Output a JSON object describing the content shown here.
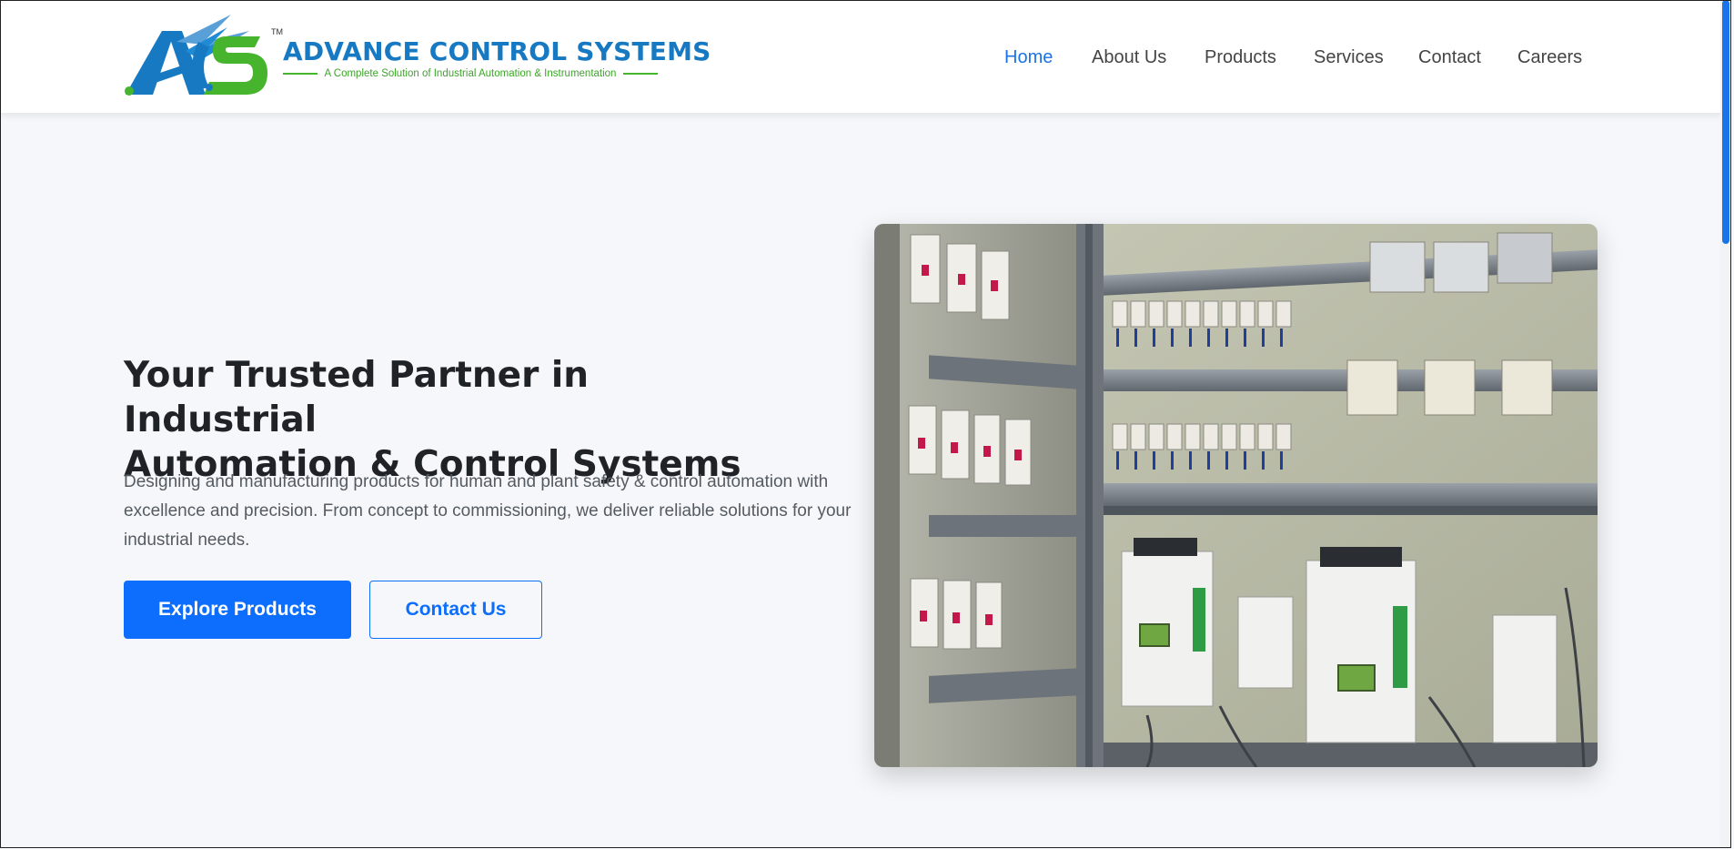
{
  "brand": {
    "logo_letters": "ACS",
    "name": "ADVANCE CONTROL SYSTEMS",
    "tagline": "A Complete Solution of Industrial Automation & Instrumentation",
    "trademark": "TM",
    "colors": {
      "primary": "#1779c2",
      "accent": "#46b52d"
    }
  },
  "nav": {
    "items": [
      {
        "label": "Home",
        "active": true
      },
      {
        "label": "About Us",
        "active": false
      },
      {
        "label": "Products",
        "active": false
      },
      {
        "label": "Services",
        "active": false
      },
      {
        "label": "Contact",
        "active": false
      },
      {
        "label": "Careers",
        "active": false
      }
    ],
    "active_color": "#1a73e8"
  },
  "hero": {
    "title_line1": "Your Trusted Partner in Industrial",
    "title_line2": "Automation & Control Systems",
    "description": "Designing and manufacturing products for human and plant safety & control automation with excellence and precision. From concept to commissioning, we deliver reliable solutions for your industrial needs.",
    "primary_button": "Explore Products",
    "secondary_button": "Contact Us",
    "image_subject": "industrial-control-panel-photo"
  },
  "theme": {
    "button_blue": "#0d6efd",
    "page_bg": "#f5f7fa"
  }
}
